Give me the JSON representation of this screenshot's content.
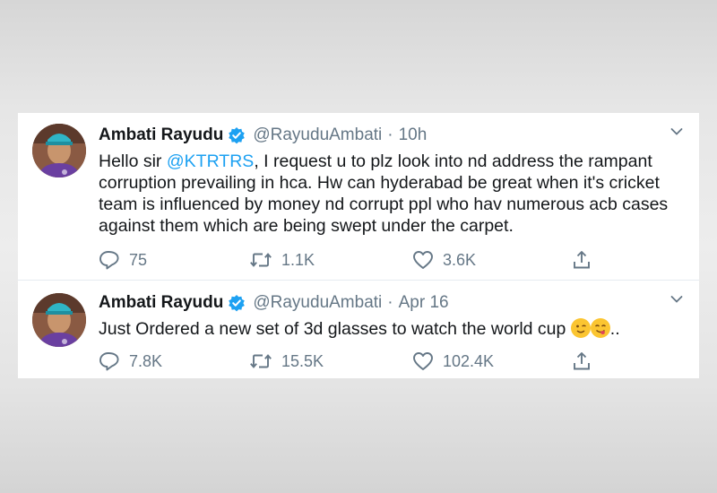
{
  "tweets": [
    {
      "name": "Ambati Rayudu",
      "handle": "@RayuduAmbati",
      "separator": "·",
      "time": "10h",
      "text_before": "Hello sir ",
      "mention": "@KTRTRS",
      "text_after": ", I request u to plz look into nd address the rampant corruption prevailing in hca. Hw can hyderabad be great when it's cricket team is influenced by money nd corrupt ppl who hav numerous acb cases against them which are being swept under the carpet.",
      "replies": "75",
      "retweets": "1.1K",
      "likes": "3.6K"
    },
    {
      "name": "Ambati Rayudu",
      "handle": "@RayuduAmbati",
      "separator": "·",
      "time": "Apr 16",
      "text": "Just Ordered a new set of 3d glasses to watch the world cup ",
      "text_tail": "..",
      "replies": "7.8K",
      "retweets": "15.5K",
      "likes": "102.4K"
    }
  ],
  "icons": {
    "verified": "verified-badge-icon",
    "reply": "reply-icon",
    "retweet": "retweet-icon",
    "like": "heart-icon",
    "share": "share-icon",
    "more": "chevron-down-icon",
    "emoji_wink": "winking-face-emoji",
    "emoji_yum": "face-savoring-food-emoji"
  },
  "colors": {
    "accent": "#1da1f2",
    "text": "#14171a",
    "secondary": "#657786"
  }
}
